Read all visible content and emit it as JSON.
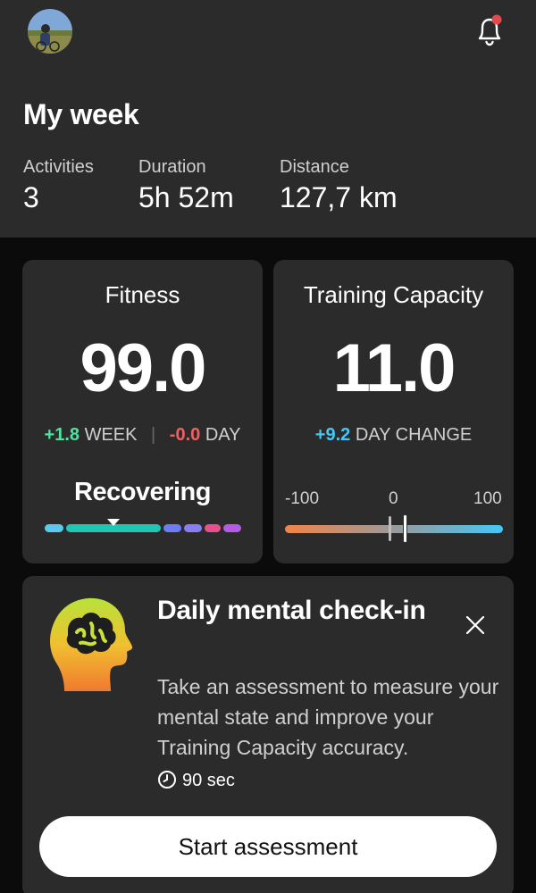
{
  "header": {
    "avatar_icon": "profile-photo",
    "notification_icon": "bell-icon",
    "notification_badge_color": "#e24b4b"
  },
  "week": {
    "title": "My week",
    "stats": [
      {
        "label": "Activities",
        "value": "3"
      },
      {
        "label": "Duration",
        "value": "5h 52m"
      },
      {
        "label": "Distance",
        "value": "127,7 km"
      }
    ]
  },
  "fitness": {
    "title": "Fitness",
    "value": "99.0",
    "week_change": "+1.8",
    "week_label": "WEEK",
    "day_change": "-0.0",
    "day_label": "DAY",
    "status": "Recovering",
    "status_scale_colors": [
      "#5bc8f0",
      "#1fc6b4",
      "#6f7bf2",
      "#8a7cf3",
      "#e8508a",
      "#b35be2"
    ]
  },
  "training_capacity": {
    "title": "Training Capacity",
    "value": "11.0",
    "day_change": "+9.2",
    "day_change_label": "DAY CHANGE",
    "scale_min": "-100",
    "scale_mid": "0",
    "scale_max": "100",
    "current_value": 11,
    "previous_value": 1.8,
    "gradient_colors": [
      "#f0844a",
      "#9a9a9a",
      "#46c6f5"
    ]
  },
  "checkin": {
    "icon": "brain-head-icon",
    "title": "Daily mental check-in",
    "description": "Take an assessment to measure your mental state and improve your Training Capacity accuracy.",
    "duration": "90 sec",
    "button_label": "Start assessment"
  }
}
